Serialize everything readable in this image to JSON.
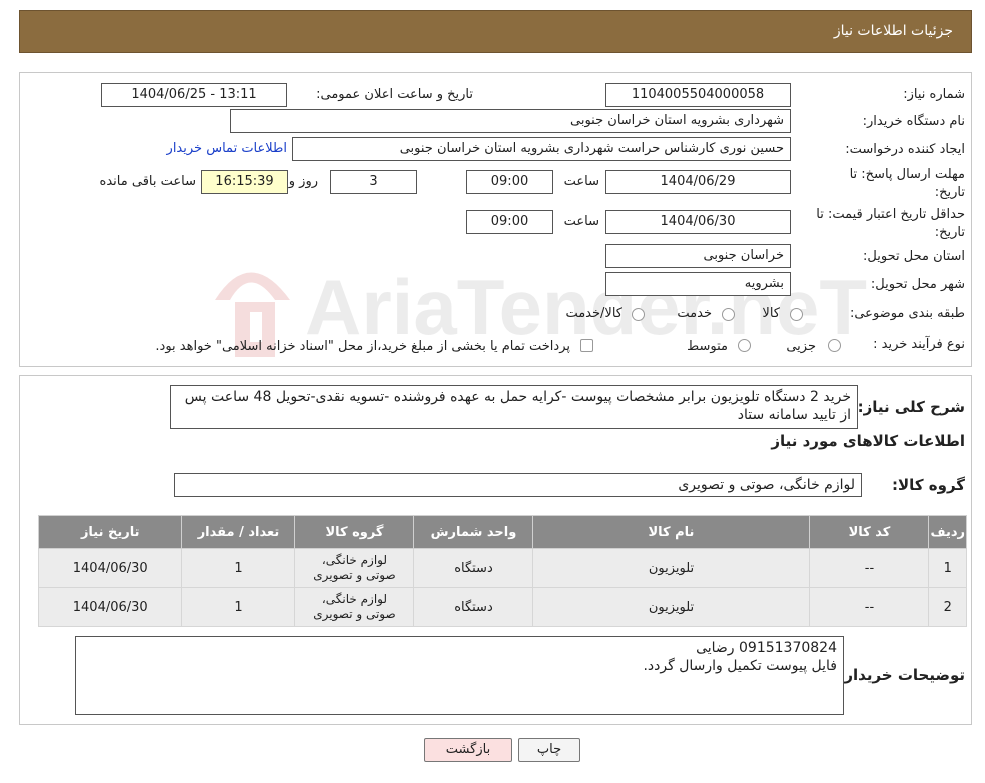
{
  "header": {
    "title": "جزئیات اطلاعات نیاز"
  },
  "form": {
    "need_number_label": "شماره نیاز:",
    "need_number": "1104005504000058",
    "announce_label": "تاریخ و ساعت اعلان عمومی:",
    "announce_value": "1404/06/25 - 13:11",
    "buyer_org_label": "نام دستگاه خریدار:",
    "buyer_org": "شهرداری بشرویه استان خراسان جنوبی",
    "requester_label": "ایجاد کننده درخواست:",
    "requester": "حسین نوری کارشناس حراست شهرداری بشرویه استان خراسان جنوبی",
    "contact_link": "اطلاعات تماس خریدار",
    "deadline_label": "مهلت ارسال پاسخ: تا تاریخ:",
    "deadline_date": "1404/06/29",
    "time_label": "ساعت",
    "deadline_time": "09:00",
    "days_value": "3",
    "days_label": "روز و",
    "remaining_time": "16:15:39",
    "remaining_label": "ساعت باقی مانده",
    "validity_label": "حداقل تاریخ اعتبار قیمت: تا تاریخ:",
    "validity_date": "1404/06/30",
    "validity_time": "09:00",
    "province_label": "استان محل تحویل:",
    "province": "خراسان جنوبی",
    "city_label": "شهر محل تحویل:",
    "city": "بشرویه",
    "category_label": "طبقه بندی موضوعی:",
    "category_options": [
      "کالا",
      "خدمت",
      "کالا/خدمت"
    ],
    "process_label": "نوع فرآیند خرید :",
    "process_options": [
      "جزیی",
      "متوسط"
    ],
    "process_note": "پرداخت تمام یا بخشی از مبلغ خرید،از محل \"اسناد خزانه اسلامی\" خواهد بود."
  },
  "summary": {
    "label": "شرح کلی نیاز:",
    "text": "خرید 2 دستگاه تلویزیون برابر مشخصات پیوست -کرایه حمل به عهده فروشنده -تسویه نقدی-تحویل 48 ساعت پس از تایید سامانه ستاد"
  },
  "goods": {
    "section_title": "اطلاعات کالاهای مورد نیاز",
    "group_label": "گروه کالا:",
    "group_value": "لوازم خانگی، صوتی و تصویری",
    "columns": [
      "ردیف",
      "کد کالا",
      "نام کالا",
      "واحد شمارش",
      "گروه کالا",
      "تعداد / مقدار",
      "تاریخ نیاز"
    ],
    "rows": [
      [
        "1",
        "--",
        "تلویزیون",
        "دستگاه",
        "لوازم خانگی، صوتی و تصویری",
        "1",
        "1404/06/30"
      ],
      [
        "2",
        "--",
        "تلویزیون",
        "دستگاه",
        "لوازم خانگی، صوتی و تصویری",
        "1",
        "1404/06/30"
      ]
    ]
  },
  "notes": {
    "label": "توضیحات خریدار:",
    "line1": "09151370824 رضایی",
    "line2": "فایل پیوست تکمیل وارسال گردد."
  },
  "buttons": {
    "print": "چاپ",
    "back": "بازگشت"
  },
  "watermark": {
    "text": "AriaTender.neT"
  },
  "colors": {
    "header_bg": "#8b6c3f",
    "table_header": "#8a8a8a",
    "link": "#1a3fc9",
    "back_button": "#fbe0e0"
  }
}
